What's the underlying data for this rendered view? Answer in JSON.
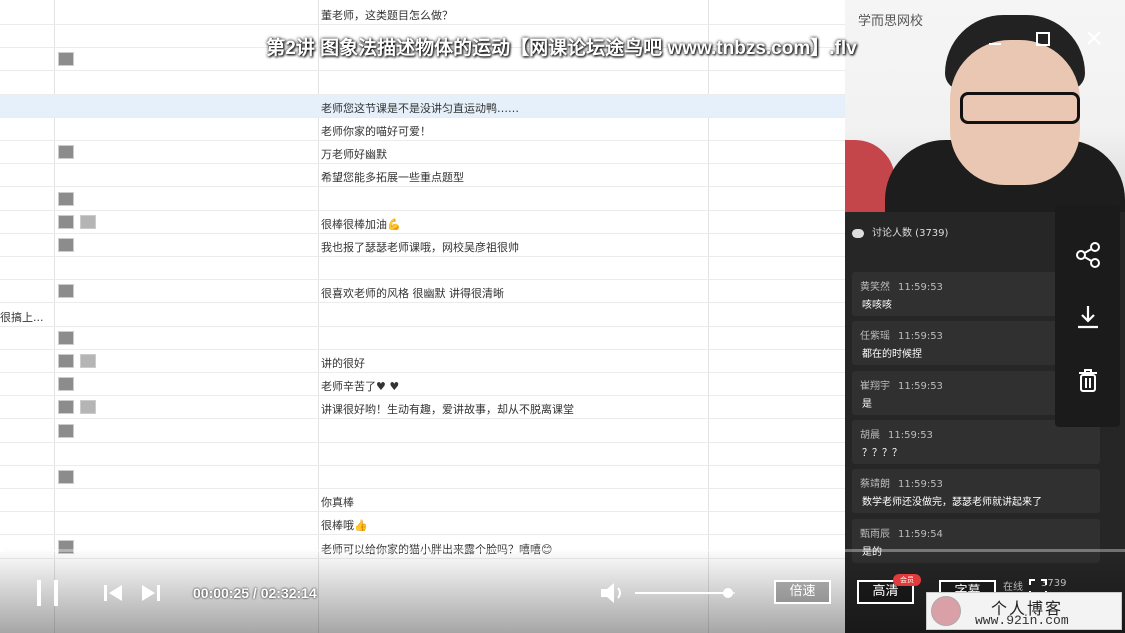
{
  "window": {
    "title": "第2讲 图象法描述物体的运动【网课论坛途鸟吧 www.tnbzs.com】.flv",
    "minimize_icon": "minimize-icon",
    "maximize_icon": "maximize-icon",
    "close_icon": "close-icon"
  },
  "sheet": {
    "rows": [
      {
        "left": "",
        "msg": "董老师，这类题目怎么做？",
        "hl": false
      },
      {
        "left": "",
        "msg": "",
        "hl": false
      },
      {
        "left": "",
        "msg": "",
        "hl": false
      },
      {
        "left": "",
        "msg": "",
        "hl": false
      },
      {
        "left": "",
        "msg": "老师您这节课是不是没讲匀直运动鸭……",
        "hl": true
      },
      {
        "left": "",
        "msg": "老师你家的喵好可爱！",
        "hl": false
      },
      {
        "left": "",
        "msg": "万老师好幽默",
        "hl": false
      },
      {
        "left": "",
        "msg": "希望您能多拓展一些重点题型",
        "hl": false
      },
      {
        "left": "",
        "msg": "",
        "hl": false
      },
      {
        "left": "",
        "msg": "很棒很棒加油💪",
        "hl": false
      },
      {
        "left": "",
        "msg": "我也报了瑟瑟老师课哦，网校吴彦祖很帅",
        "hl": false
      },
      {
        "left": "",
        "msg": "",
        "hl": false
      },
      {
        "left": "",
        "msg": "很喜欢老师的风格 很幽默 讲得很清晰",
        "hl": false
      },
      {
        "left": "很搞上...",
        "msg": "",
        "hl": false
      },
      {
        "left": "",
        "msg": "",
        "hl": false
      },
      {
        "left": "",
        "msg": "讲的很好",
        "hl": false
      },
      {
        "left": "",
        "msg": "老师辛苦了♥ ♥",
        "hl": false
      },
      {
        "left": "",
        "msg": "讲课很好哟！生动有趣，爱讲故事，却从不脱离课堂",
        "hl": false
      },
      {
        "left": "",
        "msg": "",
        "hl": false
      },
      {
        "left": "",
        "msg": "",
        "hl": false
      },
      {
        "left": "",
        "msg": "",
        "hl": false
      },
      {
        "left": "",
        "msg": "你真棒",
        "hl": false
      },
      {
        "left": "",
        "msg": "很棒哦👍",
        "hl": false
      },
      {
        "left": "",
        "msg": "老师可以给你家的猫小胖出来露个脸吗？嘻嘻😊",
        "hl": false
      }
    ]
  },
  "webcam": {
    "brand": "学而思网校"
  },
  "chat": {
    "header": "讨论人数 (3739)",
    "items": [
      {
        "name": "黄笑然",
        "time": "11:59:53",
        "text": "咳咳咳"
      },
      {
        "name": "任紫瑶",
        "time": "11:59:53",
        "text": "都在的时候捏"
      },
      {
        "name": "崔翔宇",
        "time": "11:59:53",
        "text": "是"
      },
      {
        "name": "胡晨",
        "time": "11:59:53",
        "text": "？？？？"
      },
      {
        "name": "蔡靖朗",
        "time": "11:59:53",
        "text": "数学老师还没做完，瑟瑟老师就讲起来了"
      },
      {
        "name": "甄雨辰",
        "time": "11:59:54",
        "text": "是的"
      }
    ]
  },
  "actions": {
    "share_icon": "share-icon",
    "download_icon": "download-icon",
    "delete_icon": "trash-icon"
  },
  "player": {
    "time_label": "00:00:25 / 02:32:14",
    "progress_fraction": 0.003,
    "volume_fraction": 0.93,
    "speed_label": "倍速",
    "quality_label": "高清",
    "quality_badge": "会员",
    "subtitle_label": "字幕",
    "online_label": "在线",
    "online_count": "3739",
    "icons": {
      "play_pause": "pause-icon",
      "prev": "previous-icon",
      "next": "next-icon",
      "volume": "volume-icon",
      "fullscreen": "fullscreen-icon"
    }
  },
  "watermark": {
    "title": "个人博客",
    "url": "www.92in.com"
  }
}
